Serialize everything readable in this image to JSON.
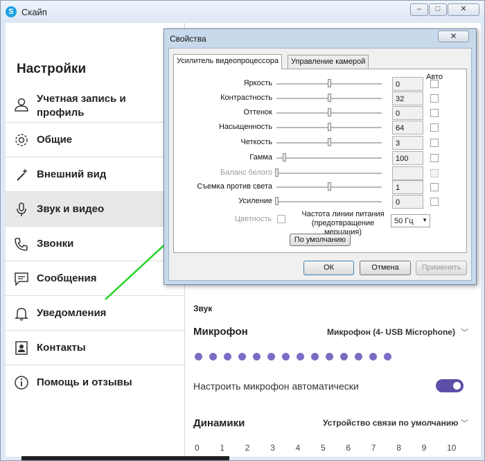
{
  "window": {
    "title": "Скайп"
  },
  "sidebar": {
    "title": "Настройки",
    "items": [
      {
        "label": "Учетная запись и профиль",
        "icon": "person-icon"
      },
      {
        "label": "Общие",
        "icon": "gear-icon"
      },
      {
        "label": "Внешний вид",
        "icon": "magic-wand-icon"
      },
      {
        "label": "Звук и видео",
        "icon": "microphone-icon",
        "active": true
      },
      {
        "label": "Звонки",
        "icon": "phone-icon"
      },
      {
        "label": "Сообщения",
        "icon": "message-icon"
      },
      {
        "label": "Уведомления",
        "icon": "bell-icon"
      },
      {
        "label": "Контакты",
        "icon": "contacts-icon"
      },
      {
        "label": "Помощь и отзывы",
        "icon": "info-icon"
      }
    ]
  },
  "main": {
    "sound_header": "Звук",
    "microphone_label": "Микрофон",
    "microphone_device": "Микрофон (4- USB Microphone)",
    "mic_level_dots": 14,
    "auto_mic_label": "Настроить микрофон автоматически",
    "auto_mic_enabled": true,
    "speakers_label": "Динамики",
    "speakers_device": "Устройство связи по умолчанию",
    "volume_scale": [
      "0",
      "1",
      "2",
      "3",
      "4",
      "5",
      "6",
      "7",
      "8",
      "9",
      "10"
    ]
  },
  "dialog": {
    "title": "Свойства",
    "close_label": "✕",
    "tabs": [
      "Усилитель видеопроцессора",
      "Управление камерой"
    ],
    "auto_header": "Авто",
    "properties": [
      {
        "label": "Яркость",
        "value": "0",
        "slider": 0.5,
        "enabled": true
      },
      {
        "label": "Контрастность",
        "value": "32",
        "slider": 0.5,
        "enabled": true
      },
      {
        "label": "Оттенок",
        "value": "0",
        "slider": 0.5,
        "enabled": true
      },
      {
        "label": "Насыщенность",
        "value": "64",
        "slider": 0.5,
        "enabled": true
      },
      {
        "label": "Четкость",
        "value": "3",
        "slider": 0.5,
        "enabled": true
      },
      {
        "label": "Гамма",
        "value": "100",
        "slider": 0.07,
        "enabled": true
      },
      {
        "label": "Баланс белого",
        "value": "",
        "slider": 0.0,
        "enabled": false
      },
      {
        "label": "Съемка против света",
        "value": "1",
        "slider": 0.5,
        "enabled": true
      },
      {
        "label": "Усиление",
        "value": "0",
        "slider": 0.0,
        "enabled": true
      }
    ],
    "color_label": "Цветность",
    "power_freq_label": "Частота линии питания (предотвращение мерцания)",
    "power_freq_value": "50 Гц",
    "default_button": "По умолчанию",
    "ok_button": "ОК",
    "cancel_button": "Отмена",
    "apply_button": "Применить"
  },
  "colors": {
    "accent_purple": "#5f4ea8",
    "arrow_green": "#22d422"
  }
}
